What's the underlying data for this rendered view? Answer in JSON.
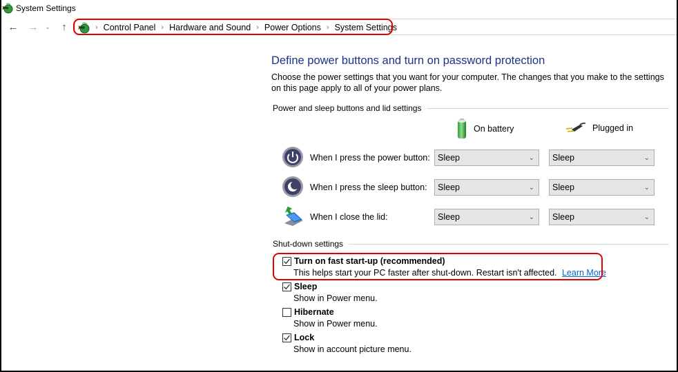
{
  "window": {
    "title": "System Settings",
    "title_icon": "power-options-icon"
  },
  "nav": {
    "back_icon": "arrow-left-icon",
    "forward_icon": "arrow-right-icon",
    "recent_icon": "chevron-down-icon",
    "up_icon": "arrow-up-icon",
    "separator": "›",
    "breadcrumbs": [
      "Control Panel",
      "Hardware and Sound",
      "Power Options",
      "System Settings"
    ]
  },
  "page": {
    "title": "Define power buttons and turn on password protection",
    "description": "Choose the power settings that you want for your computer. The changes that you make to the settings on this page apply to all of your power plans."
  },
  "power_section": {
    "header": "Power and sleep buttons and lid settings",
    "columns": [
      {
        "label": "On battery",
        "icon": "battery-icon"
      },
      {
        "label": "Plugged in",
        "icon": "power-plug-icon"
      }
    ],
    "rows": [
      {
        "label": "When I press the power button:",
        "icon": "power-button-icon",
        "on_battery": "Sleep",
        "plugged_in": "Sleep"
      },
      {
        "label": "When I press the sleep button:",
        "icon": "sleep-button-icon",
        "on_battery": "Sleep",
        "plugged_in": "Sleep"
      },
      {
        "label": "When I close the lid:",
        "icon": "laptop-lid-icon",
        "on_battery": "Sleep",
        "plugged_in": "Sleep"
      }
    ]
  },
  "shutdown_section": {
    "header": "Shut-down settings",
    "items": [
      {
        "label": "Turn on fast start-up (recommended)",
        "checked": true,
        "description": "This helps start your PC faster after shut-down. Restart isn't affected.",
        "link": "Learn More"
      },
      {
        "label": "Sleep",
        "checked": true,
        "description": "Show in Power menu."
      },
      {
        "label": "Hibernate",
        "checked": false,
        "description": "Show in Power menu."
      },
      {
        "label": "Lock",
        "checked": true,
        "description": "Show in account picture menu."
      }
    ]
  },
  "colors": {
    "title_blue": "#1e3287",
    "link_blue": "#0066cc",
    "highlight_red": "#e00000",
    "select_bg": "#e5e5e5"
  }
}
